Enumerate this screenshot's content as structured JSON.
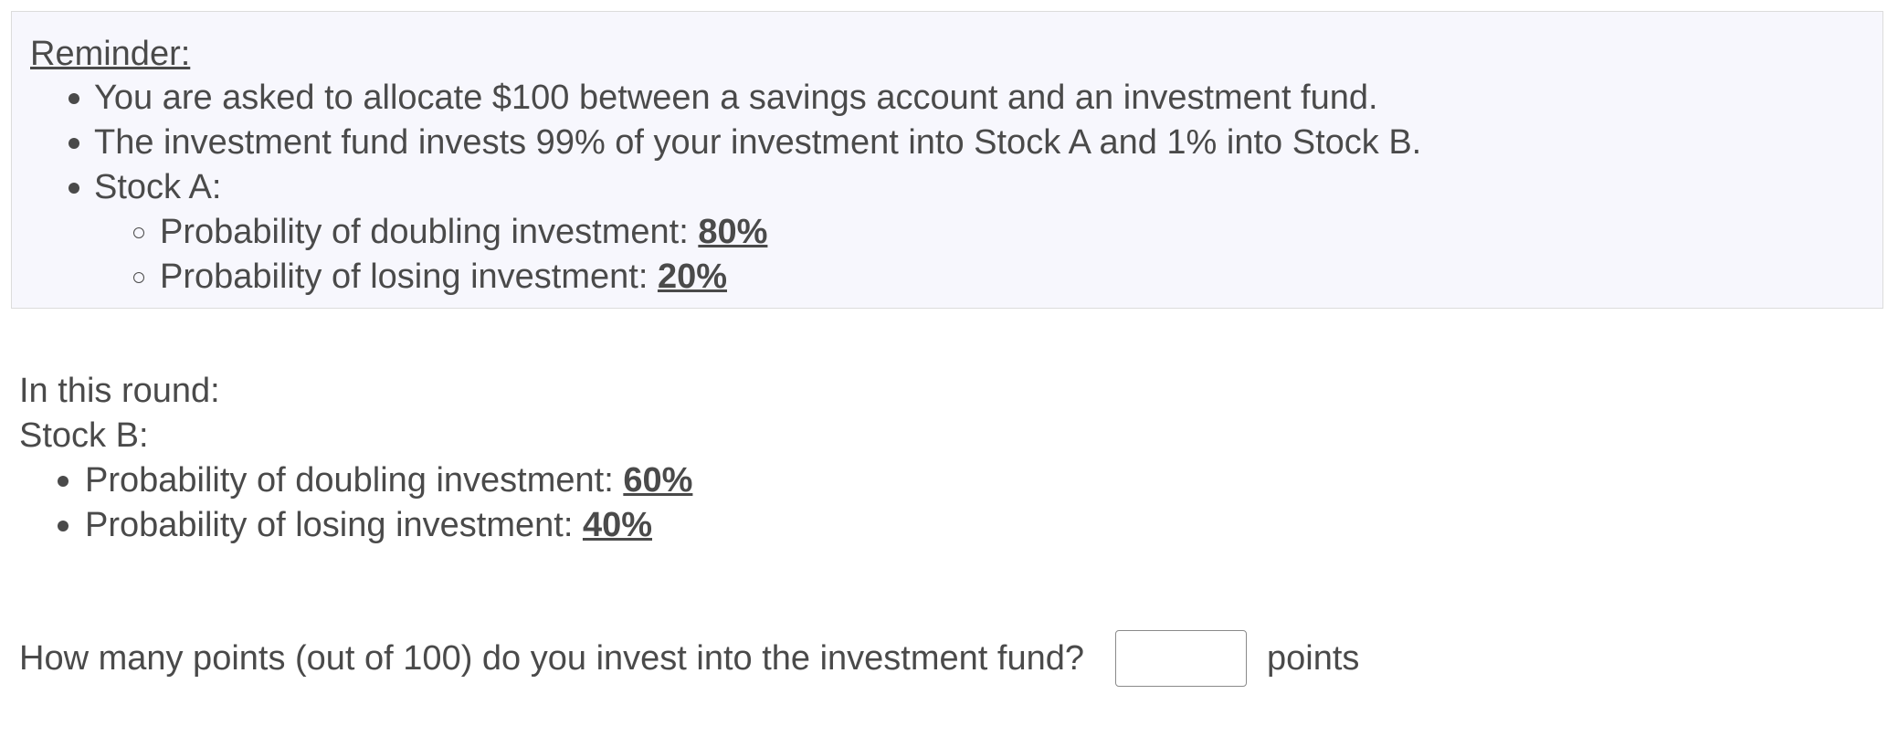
{
  "reminder": {
    "title": "Reminder:",
    "bullets": [
      "You are asked to allocate $100 between a savings account and an investment fund.",
      "The investment fund invests 99% of your investment into Stock A and 1% into Stock B.",
      "Stock A:"
    ],
    "stock_a": {
      "doubling_label": "Probability of doubling investment: ",
      "doubling_value": "80%",
      "losing_label": "Probability of losing investment: ",
      "losing_value": "20%"
    }
  },
  "round": {
    "intro": "In this round:",
    "stock_label": "Stock B:",
    "stock_b": {
      "doubling_label": "Probability of doubling investment: ",
      "doubling_value": "60%",
      "losing_label": "Probability of losing investment: ",
      "losing_value": "40%"
    }
  },
  "question": {
    "text": "How many points (out of 100) do you invest into the investment fund?",
    "input_value": "",
    "unit": "points"
  }
}
